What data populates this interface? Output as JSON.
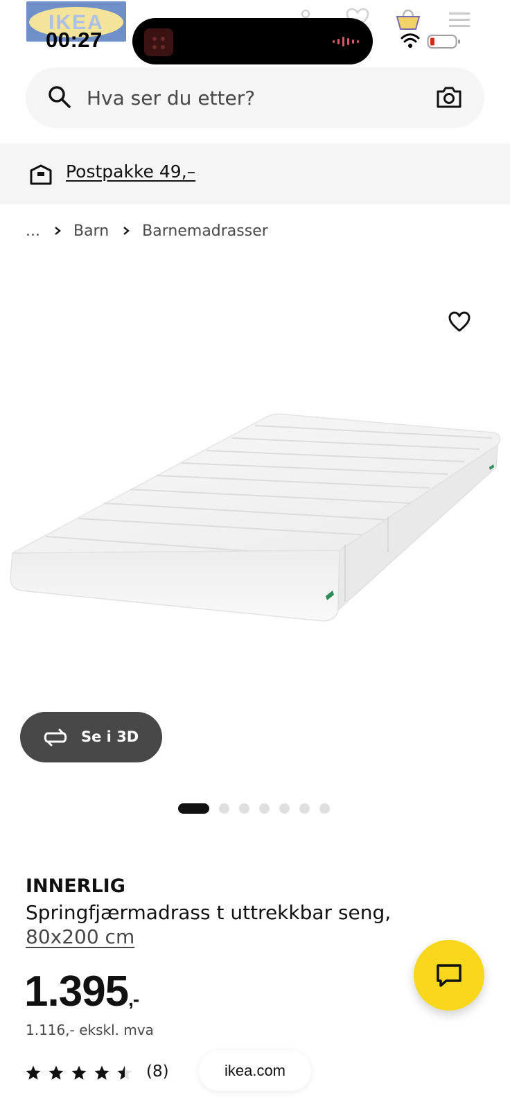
{
  "status_bar": {
    "time": "00:27",
    "logo_text": "IKEA"
  },
  "search": {
    "placeholder": "Hva ser du etter?"
  },
  "delivery": {
    "label": "Postpakke 49,–"
  },
  "breadcrumb": {
    "ellipsis": "...",
    "items": [
      "Barn",
      "Barnemadrasser"
    ]
  },
  "gallery": {
    "view_3d_label": "Se i 3D",
    "image_count": 7,
    "active_index": 0
  },
  "product": {
    "name": "INNERLIG",
    "description": "Springfjærmadrass t uttrekkbar seng,",
    "size": "80x200 cm",
    "price_whole": "1.395",
    "price_suffix": ",-",
    "price_ex_vat": "1.116,- ekskl. mva",
    "rating": 4.5,
    "review_count": "(8)"
  },
  "browser": {
    "domain": "ikea.com"
  },
  "colors": {
    "chat_button": "#f9d71c",
    "band_background": "#f5f5f5",
    "view3d_button": "#484848"
  }
}
